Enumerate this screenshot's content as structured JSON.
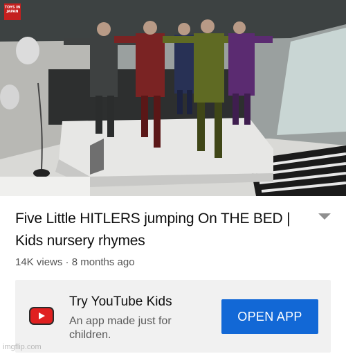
{
  "video": {
    "channel_badge": "TOYS IN JAPAN",
    "title": "Five Little HITLERS jumping On THE BED | Kids nursery rhymes",
    "meta": "14K views · 8 months ago"
  },
  "promo": {
    "heading": "Try YouTube Kids",
    "text": "An app made just for children.",
    "button_label": "OPEN APP",
    "logo_icon": "youtube-kids-icon"
  },
  "watermark": "imgflip.com",
  "colors": {
    "accent": "#1268d6",
    "logo_red": "#e02020",
    "card_bg": "#f1f1f1"
  }
}
